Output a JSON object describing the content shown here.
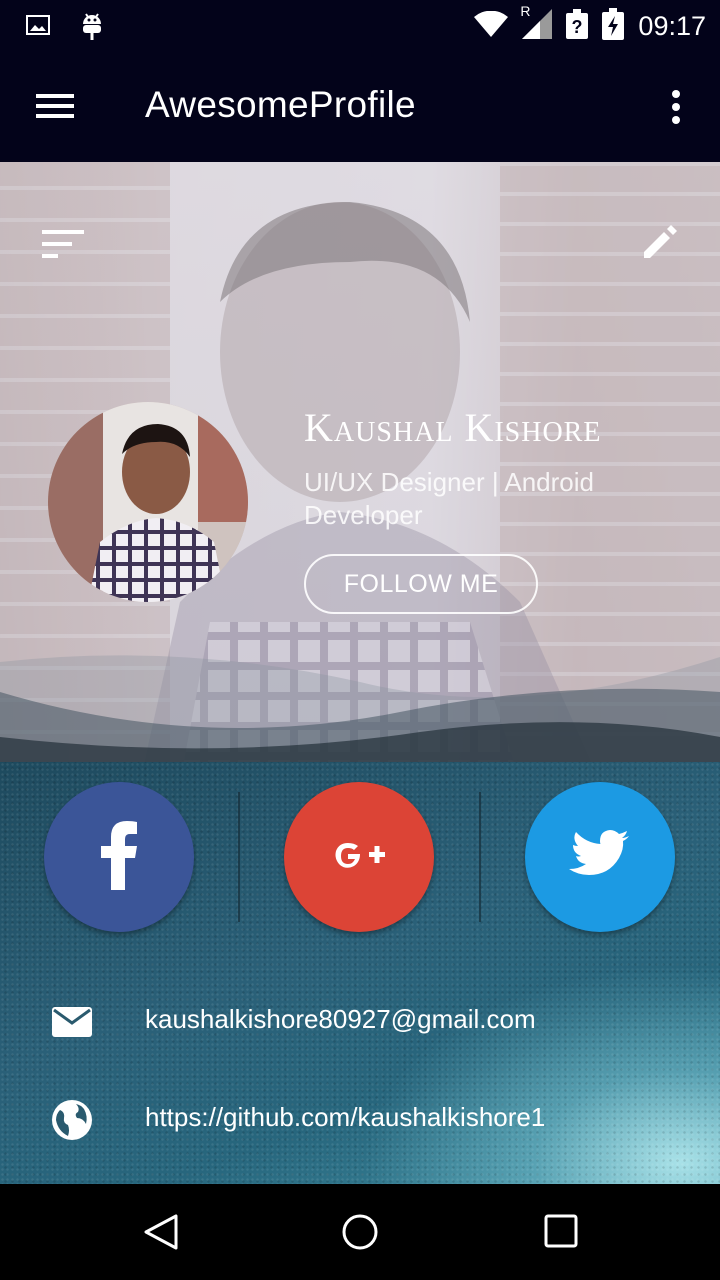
{
  "status_bar": {
    "time": "09:17",
    "network_label": "R",
    "icons": [
      "image-icon",
      "android-icon",
      "wifi-icon",
      "signal-icon",
      "battery-icon"
    ]
  },
  "toolbar": {
    "title": "AwesomeProfile",
    "menu_icon": "hamburger-icon",
    "overflow_icon": "more-vert-icon"
  },
  "profile": {
    "name": "Kaushal Kishore",
    "role": "UI/UX Designer | Android Developer",
    "follow_label": "FOLLOW ME"
  },
  "social": [
    {
      "name": "facebook",
      "color": "#3b5598",
      "glyph": "f"
    },
    {
      "name": "google-plus",
      "color": "#dc4436",
      "glyph": "G+"
    },
    {
      "name": "twitter",
      "color": "#1c9ae3",
      "glyph": "bird"
    }
  ],
  "contact": {
    "email": "kaushalkishore80927@gmail.com",
    "website": "https://github.com/kaushalkishore1"
  },
  "nav": [
    "back-icon",
    "home-icon",
    "recents-icon"
  ]
}
